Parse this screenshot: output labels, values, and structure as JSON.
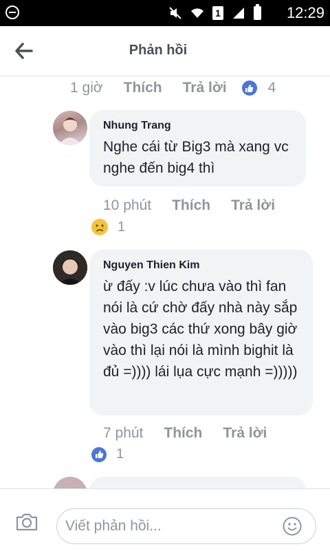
{
  "status_bar": {
    "time": "12:29",
    "sim": "1"
  },
  "header": {
    "title": "Phản hồi"
  },
  "top_comment_actions": {
    "time": "1 giờ",
    "like": "Thích",
    "reply": "Trả lời",
    "reaction_count": "4"
  },
  "comments": [
    {
      "author": "Nhung Trang",
      "text": "Nghe cái từ Big3 mà xang vc nghe đến big4 thì",
      "time": "10 phút",
      "like": "Thích",
      "reply": "Trả lời",
      "reaction": "sad-emoji",
      "reaction_count": "1"
    },
    {
      "author": "Nguyen Thien Kim",
      "text": "ừ đấy :v lúc chưa vào thì fan nói là cứ chờ đấy nhà này sắp vào big3 các thứ xong bây giờ vào thì lại nói là mình bighit là đủ =)))) lái lụa cực mạnh =)))))",
      "time": "7 phút",
      "like": "Thích",
      "reply": "Trả lời",
      "reaction": "like-icon",
      "reaction_count": "1"
    }
  ],
  "composer": {
    "placeholder": "Viết phản hồi..."
  },
  "colors": {
    "like_blue": "#4a76d6",
    "bubble_bg": "#f2f3f5",
    "meta_grey": "#90949c"
  }
}
